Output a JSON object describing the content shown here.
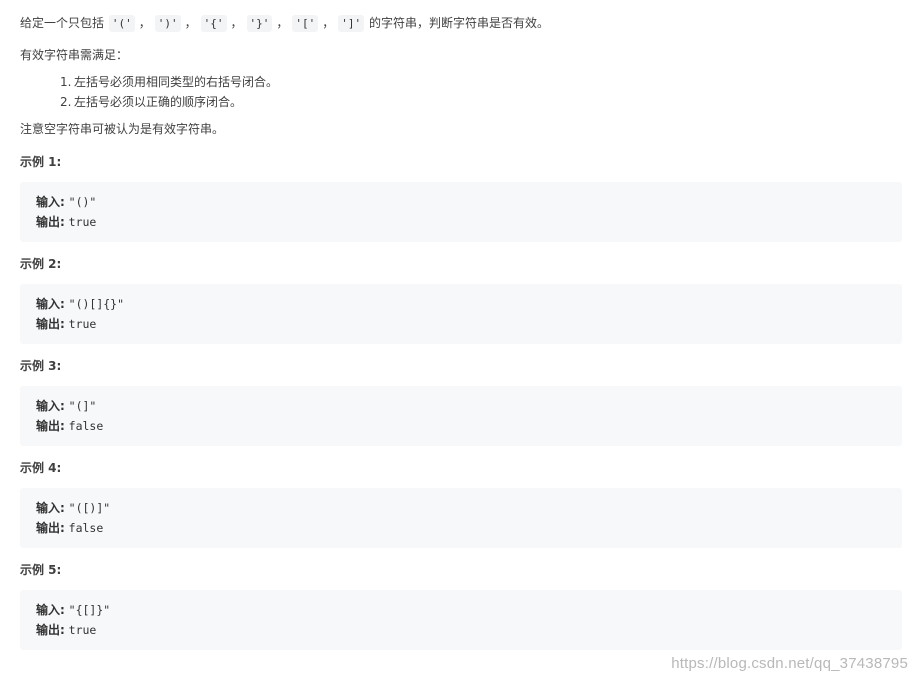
{
  "intro": {
    "before": "给定一个只包括",
    "chars": [
      "'('",
      "')'",
      "'{'",
      "'}'",
      "'['",
      "']'"
    ],
    "separator": "，",
    "after": "的字符串，判断字符串是否有效。"
  },
  "requirement_heading": "有效字符串需满足：",
  "rules": [
    {
      "num": "1.",
      "text": "左括号必须用相同类型的右括号闭合。"
    },
    {
      "num": "2.",
      "text": "左括号必须以正确的顺序闭合。"
    }
  ],
  "note": "注意空字符串可被认为是有效字符串。",
  "examples": [
    {
      "title": "示例 1:",
      "input_label": "输入:",
      "input": "\"()\"",
      "output_label": "输出:",
      "output": "true"
    },
    {
      "title": "示例 2:",
      "input_label": "输入:",
      "input": "\"()[]{}\"",
      "output_label": "输出:",
      "output": "true"
    },
    {
      "title": "示例 3:",
      "input_label": "输入:",
      "input": "\"(]\"",
      "output_label": "输出:",
      "output": "false"
    },
    {
      "title": "示例 4:",
      "input_label": "输入:",
      "input": "\"([)]\"",
      "output_label": "输出:",
      "output": "false"
    },
    {
      "title": "示例 5:",
      "input_label": "输入:",
      "input": "\"{[]}\"",
      "output_label": "输出:",
      "output": "true"
    }
  ],
  "watermark": "https://blog.csdn.net/qq_37438795"
}
